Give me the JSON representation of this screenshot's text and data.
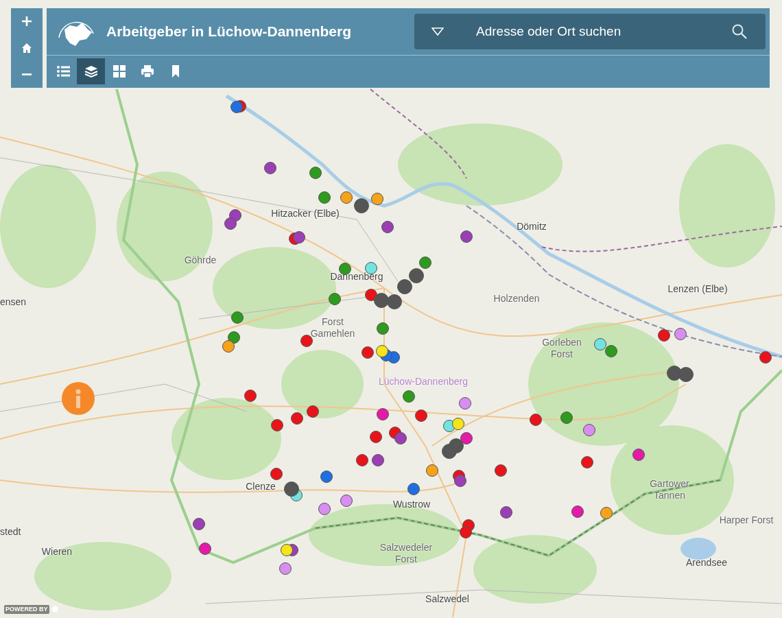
{
  "title": "Arbeitgeber in Lüchow-Dannenberg",
  "map_controls": [
    {
      "kind": "zoom_in"
    },
    {
      "kind": "home"
    },
    {
      "kind": "zoom_out"
    }
  ],
  "tools": [
    {
      "kind": "list",
      "selected": false
    },
    {
      "kind": "layers",
      "selected": true
    },
    {
      "kind": "gallery",
      "selected": false
    },
    {
      "kind": "print",
      "selected": false
    },
    {
      "kind": "bookmark",
      "selected": false
    }
  ],
  "search": {
    "placeholder": "Adresse oder Ort suchen"
  },
  "map_labels": [
    {
      "text": "Hitzacker (Elbe)",
      "kind": "town"
    },
    {
      "text": "Dannenberg",
      "kind": "town"
    },
    {
      "text": "Dömitz",
      "kind": "town"
    },
    {
      "text": "Göhrde",
      "kind": "area"
    },
    {
      "text": "ensen",
      "kind": "town"
    },
    {
      "text": "Holzenden",
      "kind": "area"
    },
    {
      "text": "Lenzen (Elbe)",
      "kind": "town"
    },
    {
      "text": "Forst Gamehlen",
      "kind": "area"
    },
    {
      "text": "Gorleben Forst",
      "kind": "area"
    },
    {
      "text": "Lüchow-Dannenberg",
      "kind": "district"
    },
    {
      "text": "Gartower Tannen",
      "kind": "area"
    },
    {
      "text": "Harper Forst",
      "kind": "area"
    },
    {
      "text": "stedt",
      "kind": "town"
    },
    {
      "text": "Wieren",
      "kind": "town"
    },
    {
      "text": "Clenze",
      "kind": "town"
    },
    {
      "text": "Wustrow",
      "kind": "town"
    },
    {
      "text": "Salzwedeler Forst",
      "kind": "area"
    },
    {
      "text": "Arendsee",
      "kind": "town"
    },
    {
      "text": "Salzwedel",
      "kind": "town"
    }
  ],
  "markers": [
    {
      "color": "#e8141a"
    },
    {
      "color": "#e8141a"
    },
    {
      "color": "#e8141a"
    },
    {
      "color": "#e8141a"
    },
    {
      "color": "#e8141a"
    },
    {
      "color": "#e8141a"
    },
    {
      "color": "#e8141a"
    },
    {
      "color": "#e8141a"
    },
    {
      "color": "#e8141a"
    },
    {
      "color": "#e8141a"
    },
    {
      "color": "#e8141a"
    },
    {
      "color": "#e8141a"
    },
    {
      "color": "#e8141a"
    },
    {
      "color": "#e8141a"
    },
    {
      "color": "#e8141a"
    },
    {
      "color": "#e8141a"
    },
    {
      "color": "#e8141a"
    },
    {
      "color": "#e8141a"
    },
    {
      "color": "#e8141a"
    },
    {
      "color": "#e8141a"
    },
    {
      "color": "#e8141a"
    },
    {
      "color": "#e8141a"
    },
    {
      "color": "#2e9a1e"
    },
    {
      "color": "#2e9a1e"
    },
    {
      "color": "#2e9a1e"
    },
    {
      "color": "#2e9a1e"
    },
    {
      "color": "#2e9a1e"
    },
    {
      "color": "#2e9a1e"
    },
    {
      "color": "#2e9a1e"
    },
    {
      "color": "#2e9a1e"
    },
    {
      "color": "#2e9a1e"
    },
    {
      "color": "#2e9a1e"
    },
    {
      "color": "#2e9a1e"
    },
    {
      "color": "#9b3fb5"
    },
    {
      "color": "#9b3fb5"
    },
    {
      "color": "#9b3fb5"
    },
    {
      "color": "#9b3fb5"
    },
    {
      "color": "#9b3fb5"
    },
    {
      "color": "#9b3fb5"
    },
    {
      "color": "#9b3fb5"
    },
    {
      "color": "#9b3fb5"
    },
    {
      "color": "#9b3fb5"
    },
    {
      "color": "#9b3fb5"
    },
    {
      "color": "#9b3fb5"
    },
    {
      "color": "#9b3fb5"
    },
    {
      "color": "#f7a21b"
    },
    {
      "color": "#f7a21b"
    },
    {
      "color": "#f7a21b"
    },
    {
      "color": "#f7a21b"
    },
    {
      "color": "#f7a21b"
    },
    {
      "color": "#1f6fe0"
    },
    {
      "color": "#1f6fe0"
    },
    {
      "color": "#1f6fe0"
    },
    {
      "color": "#1f6fe0"
    },
    {
      "color": "#1f6fe0"
    },
    {
      "color": "#e31ba8"
    },
    {
      "color": "#e31ba8"
    },
    {
      "color": "#e31ba8"
    },
    {
      "color": "#e31ba8"
    },
    {
      "color": "#e31ba8"
    },
    {
      "color": "#d88ef0"
    },
    {
      "color": "#d88ef0"
    },
    {
      "color": "#d88ef0"
    },
    {
      "color": "#d88ef0"
    },
    {
      "color": "#d88ef0"
    },
    {
      "color": "#d88ef0"
    },
    {
      "color": "#72e3e0"
    },
    {
      "color": "#72e3e0"
    },
    {
      "color": "#72e3e0"
    },
    {
      "color": "#72e3e0"
    },
    {
      "color": "#f5e31b"
    },
    {
      "color": "#f5e31b"
    },
    {
      "color": "#f5e31b"
    },
    {
      "color": "#555555"
    },
    {
      "color": "#555555"
    },
    {
      "color": "#555555"
    },
    {
      "color": "#555555"
    },
    {
      "color": "#555555"
    },
    {
      "color": "#555555"
    },
    {
      "color": "#555555"
    },
    {
      "color": "#555555"
    },
    {
      "color": "#555555"
    },
    {
      "color": "#555555"
    }
  ],
  "attribution": "POWERED BY"
}
